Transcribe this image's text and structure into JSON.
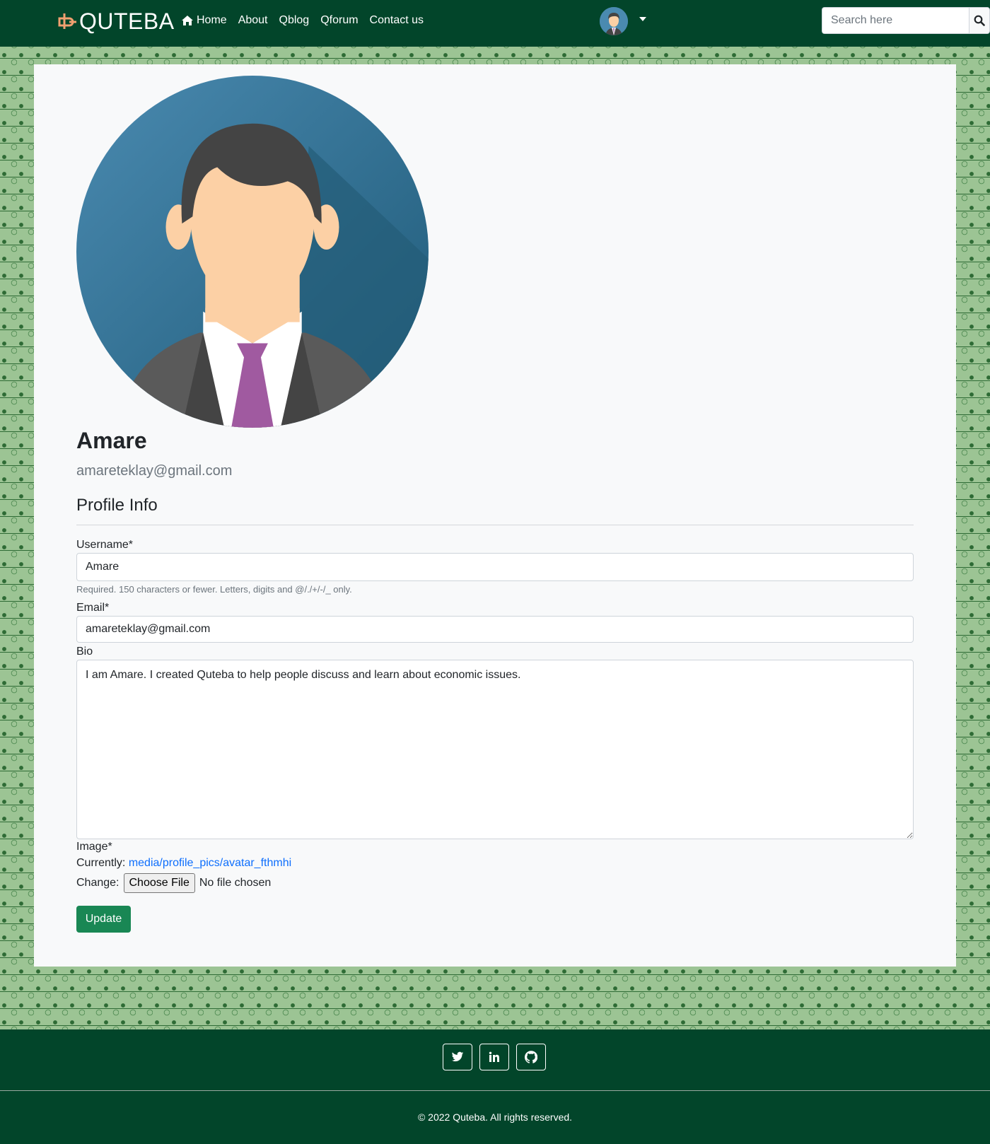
{
  "navbar": {
    "brand": "QUTEBA",
    "links": [
      "Home",
      "About",
      "Qblog",
      "Qforum",
      "Contact us"
    ],
    "search_placeholder": "Search here"
  },
  "profile": {
    "name": "Amare",
    "email": "amareteklay@gmail.com",
    "section_title": "Profile Info"
  },
  "form": {
    "username_label": "Username*",
    "username_value": "Amare",
    "username_help": "Required. 150 characters or fewer. Letters, digits and @/./+/-/_ only.",
    "email_label": "Email*",
    "email_value": "amareteklay@gmail.com",
    "bio_label": "Bio",
    "bio_value": "I am Amare. I created Quteba to help people discuss and learn about economic issues.",
    "image_label": "Image*",
    "currently_label": "Currently:",
    "currently_link": "media/profile_pics/avatar_fthmhi",
    "change_label": "Change:",
    "choose_file": "Choose File",
    "no_file": "No file chosen",
    "submit": "Update"
  },
  "footer": {
    "social_icons": [
      "twitter-icon",
      "linkedin-icon",
      "github-icon"
    ],
    "copyright": "2022 Quteba. All rights reserved."
  },
  "colors": {
    "nav_bg": "#02452a",
    "page_pattern": "#9cc494",
    "accent_orange": "#f0a070",
    "button_green": "#198754",
    "link_blue": "#0d6efd"
  }
}
